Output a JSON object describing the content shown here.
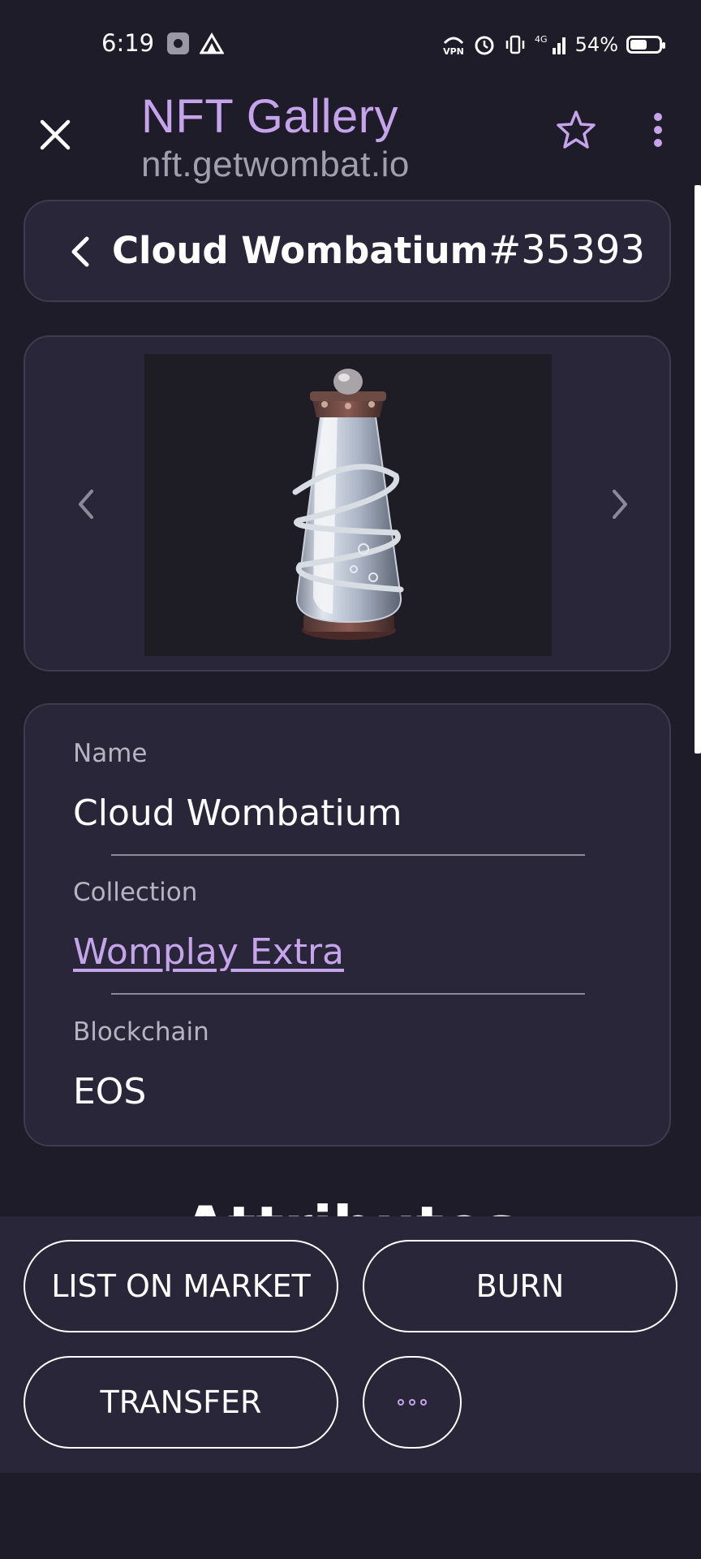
{
  "status_bar": {
    "time": "6:19",
    "battery": "54%",
    "icons": [
      "gear-icon",
      "delta-icon",
      "vpn-icon",
      "alarm-icon",
      "vibrate-icon",
      "signal-4g-icon",
      "battery-icon"
    ],
    "vpn_label": "VPN",
    "network_label": "4G"
  },
  "app_bar": {
    "title": "NFT Gallery",
    "url": "nft.getwombat.io"
  },
  "nft_header": {
    "name": "Cloud Wombatium",
    "id": "#35393"
  },
  "details": {
    "name_label": "Name",
    "name_value": "Cloud Wombatium",
    "collection_label": "Collection",
    "collection_value": "Womplay Extra",
    "blockchain_label": "Blockchain",
    "blockchain_value": "EOS"
  },
  "attributes_heading": "Attributes",
  "actions": {
    "list": "LIST ON MARKET",
    "burn": "BURN",
    "transfer": "TRANSFER"
  },
  "colors": {
    "background": "#1e1c29",
    "card": "#282638",
    "accent": "#c6a4ec"
  }
}
